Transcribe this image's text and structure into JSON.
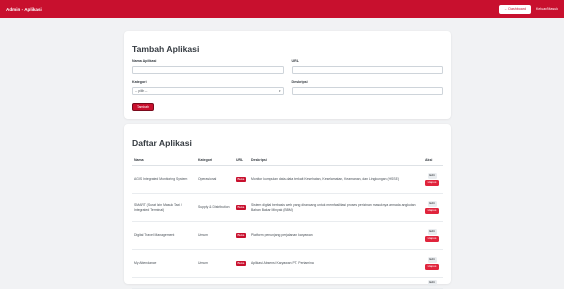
{
  "navbar": {
    "brand": "Admin - Aplikasi",
    "dashboard_button": "← Dashboard",
    "logout_link": "Keluar/Masuk"
  },
  "form": {
    "title": "Tambah Aplikasi",
    "name_label": "Nama Aplikasi",
    "url_label": "URL",
    "category_label": "Kategori",
    "category_selected": "-- pilih --",
    "description_label": "Deskripsi",
    "submit_label": "Tambah"
  },
  "list": {
    "title": "Daftar Aplikasi",
    "columns": [
      "Nama",
      "Kategori",
      "URL",
      "Deskripsi",
      "Aksi"
    ],
    "rows": [
      {
        "name": "AGIS Integrated Monitoring System",
        "category": "Operasional",
        "url_badge": "Buka",
        "description": "Monitor kumpulan data-data terkait Kesehatan, Keselamatan, Keamanan, dan Lingkungan (HSSE)",
        "edit": "Edit",
        "delete": "Hapus"
      },
      {
        "name": "SMART (Surat Izin Masuk Taxi / Integrated Terminal)",
        "category": "Supply & Distribution",
        "url_badge": "Buka",
        "description": "Sistem digital berbasis web yang dirancang untuk memfasilitasi proses perizinan masuknya armada angkutan Bahan Bakar Minyak (BBM)",
        "edit": "Edit",
        "delete": "Hapus"
      },
      {
        "name": "Digital Travel Management",
        "category": "Umum",
        "url_badge": "Buka",
        "description": "Platform penunjang perjalanan karyawan",
        "edit": "Edit",
        "delete": "Hapus"
      },
      {
        "name": "My Attendance",
        "category": "Umum",
        "url_badge": "Buka",
        "description": "Aplikasi Absensi Karyawan PT. Pertamina",
        "edit": "Edit",
        "delete": "Hapus"
      },
      {
        "name": "",
        "category": "",
        "url_badge": "",
        "description": "",
        "edit": "Edit",
        "delete": ""
      }
    ]
  }
}
